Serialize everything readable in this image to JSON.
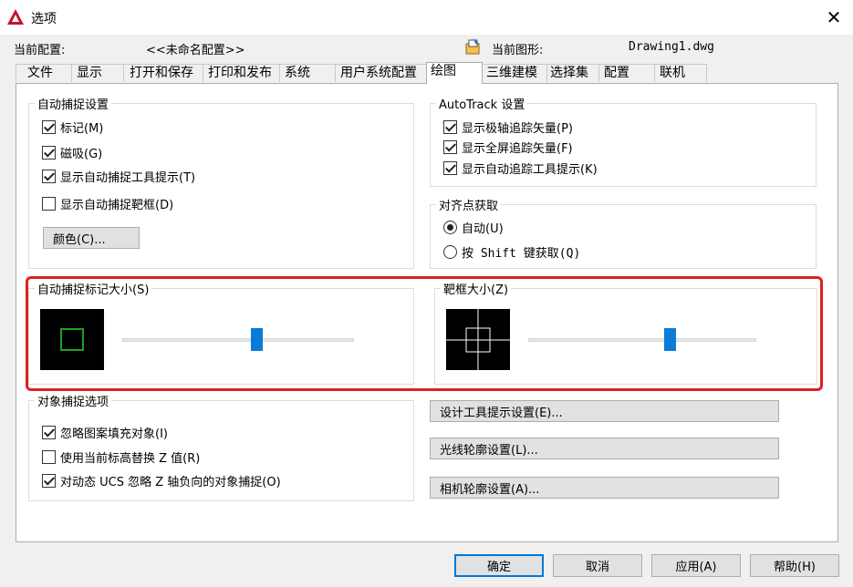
{
  "window": {
    "title": "选项",
    "close_glyph": "✕"
  },
  "header": {
    "profile_label": "当前配置:",
    "profile_value": "<<未命名配置>>",
    "drawing_label": "当前图形:",
    "drawing_value": "Drawing1.dwg"
  },
  "tabs": [
    "文件",
    "显示",
    "打开和保存",
    "打印和发布",
    "系统",
    "用户系统配置",
    "绘图",
    "三维建模",
    "选择集",
    "配置",
    "联机"
  ],
  "active_tab": "绘图",
  "autosnap": {
    "legend": "自动捕捉设置",
    "items": [
      {
        "label": "标记(M)",
        "checked": true
      },
      {
        "label": "磁吸(G)",
        "checked": true
      },
      {
        "label": "显示自动捕捉工具提示(T)",
        "checked": true
      },
      {
        "label": "显示自动捕捉靶框(D)",
        "checked": false
      }
    ],
    "color_button": "颜色(C)..."
  },
  "autotrack": {
    "legend": "AutoTrack 设置",
    "items": [
      {
        "label": "显示极轴追踪矢量(P)",
        "checked": true
      },
      {
        "label": "显示全屏追踪矢量(F)",
        "checked": true
      },
      {
        "label": "显示自动追踪工具提示(K)",
        "checked": true
      }
    ]
  },
  "alignment": {
    "legend": "对齐点获取",
    "options": [
      {
        "label": "自动(U)",
        "selected": true
      },
      {
        "label": "按 Shift 键获取(Q)",
        "selected": false
      }
    ]
  },
  "marker_size": {
    "legend": "自动捕捉标记大小(S)",
    "slider_fraction": 0.58,
    "marker_color": "#1fa01f"
  },
  "aperture_size": {
    "legend": "靶框大小(Z)",
    "slider_fraction": 0.62
  },
  "object_snap": {
    "legend": "对象捕捉选项",
    "items": [
      {
        "label": "忽略图案填充对象(I)",
        "checked": true
      },
      {
        "label": "使用当前标高替换 Z 值(R)",
        "checked": false
      },
      {
        "label": "对动态 UCS 忽略 Z 轴负向的对象捕捉(O)",
        "checked": true
      }
    ]
  },
  "side_buttons": [
    "设计工具提示设置(E)...",
    "光线轮廓设置(L)...",
    "相机轮廓设置(A)..."
  ],
  "footer_buttons": {
    "ok": "确定",
    "cancel": "取消",
    "apply": "应用(A)",
    "help": "帮助(H)"
  },
  "colors": {
    "accent": "#0078d7",
    "highlight": "#e02020",
    "slider_thumb": "#0a7bd6"
  },
  "icons": {
    "app": "autocad-icon",
    "drawing": "drawing-file-icon",
    "close": "close-icon"
  }
}
